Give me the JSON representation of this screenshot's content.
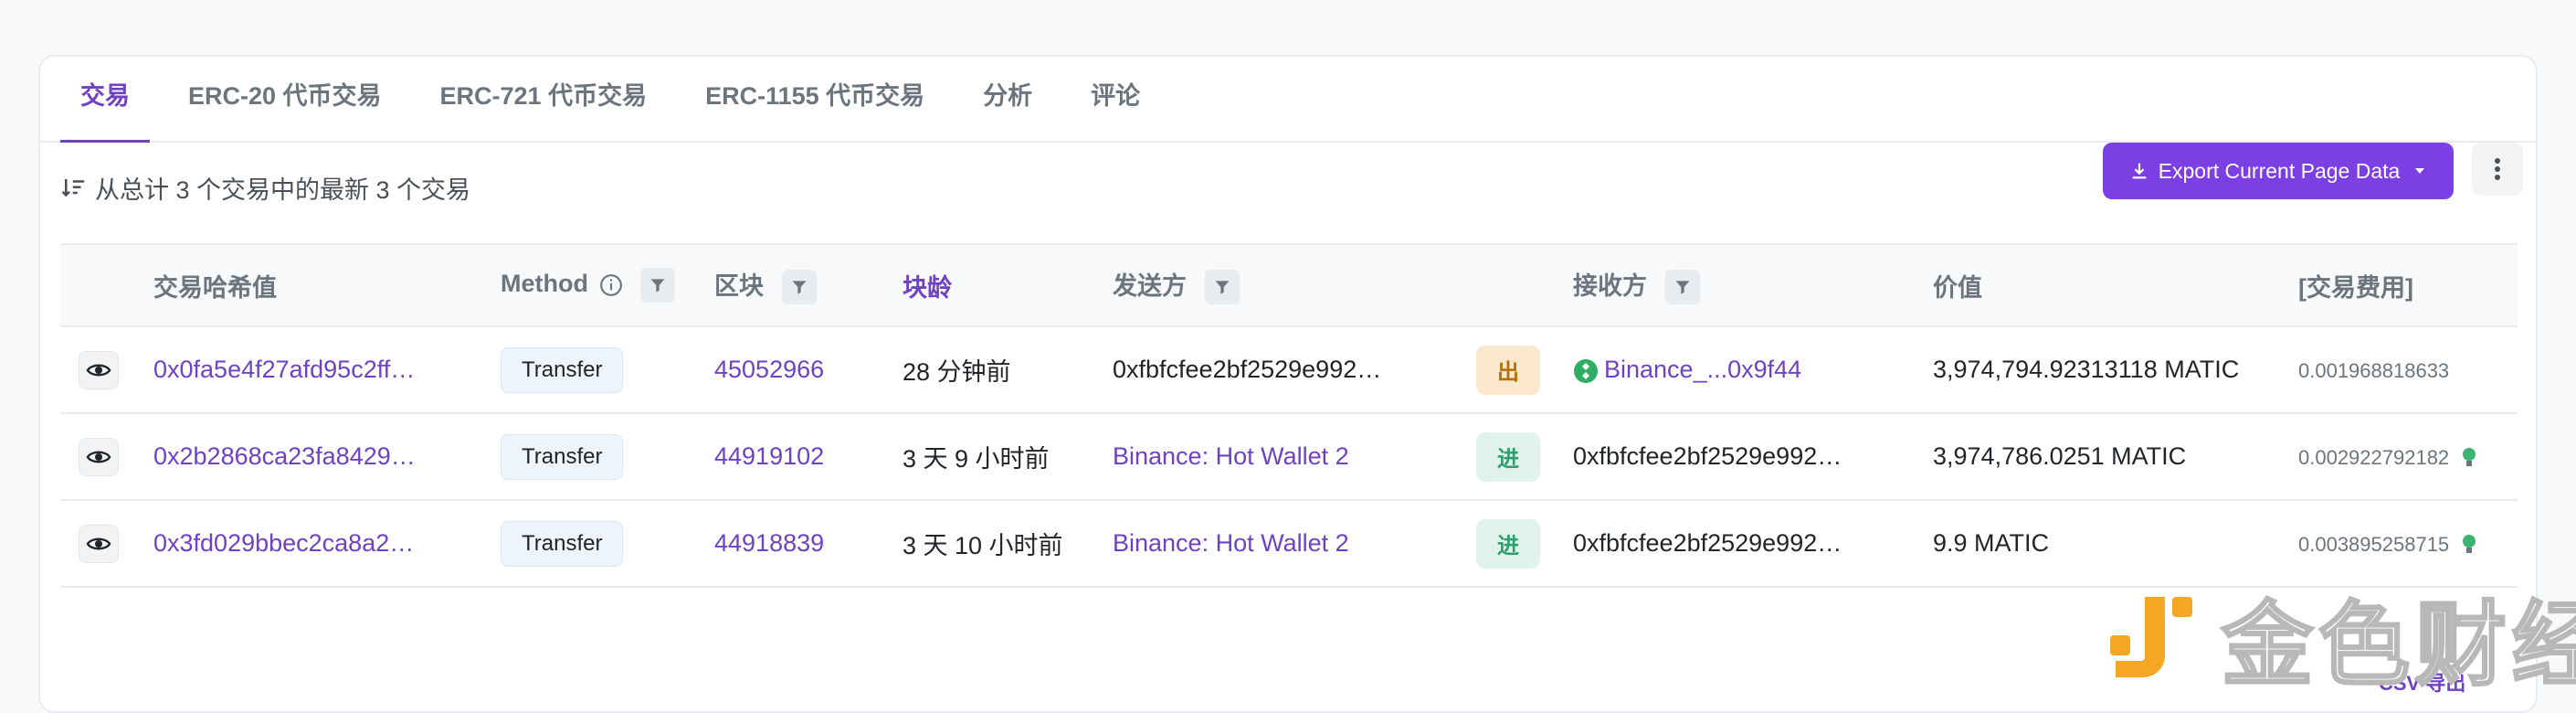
{
  "tabs": [
    {
      "label": "交易",
      "active": true
    },
    {
      "label": "ERC-20 代币交易"
    },
    {
      "label": "ERC-721 代币交易"
    },
    {
      "label": "ERC-1155 代币交易"
    },
    {
      "label": "分析"
    },
    {
      "label": "评论"
    }
  ],
  "summary": "从总计 3 个交易中的最新 3 个交易",
  "export_label": "Export Current Page Data",
  "columns": {
    "hash": "交易哈希值",
    "method": "Method",
    "block": "区块",
    "age": "块龄",
    "from": "发送方",
    "to": "接收方",
    "value": "价值",
    "fee": "[交易费用]"
  },
  "rows": [
    {
      "hash": "0x0fa5e4f27afd95c2ff…",
      "method": "Transfer",
      "block": "45052966",
      "age": "28 分钟前",
      "from": "0xfbfcfee2bf2529e992…",
      "from_link": false,
      "direction": "出",
      "to": "Binance_...0x9f44",
      "to_link": true,
      "value": "3,974,794.92313118 MATIC",
      "fee": "0.001968818633"
    },
    {
      "hash": "0x2b2868ca23fa8429…",
      "method": "Transfer",
      "block": "44919102",
      "age": "3 天 9 小时前",
      "from": "Binance: Hot Wallet 2",
      "from_link": true,
      "direction": "进",
      "to": "0xfbfcfee2bf2529e992…",
      "to_link": false,
      "value": "3,974,786.0251 MATIC",
      "fee": "0.002922792182"
    },
    {
      "hash": "0x3fd029bbec2ca8a2…",
      "method": "Transfer",
      "block": "44918839",
      "age": "3 天 10 小时前",
      "from": "Binance: Hot Wallet 2",
      "from_link": true,
      "direction": "进",
      "to": "0xfbfcfee2bf2529e992…",
      "to_link": false,
      "value": "9.9 MATIC",
      "fee": "0.003895258715"
    }
  ],
  "csv_label": "CSV 导出",
  "watermark": "金色财经",
  "colors": {
    "accent": "#6f42c1",
    "button": "#7b3fe4",
    "out_badge": "#fbe8cc",
    "in_badge": "#dff3ea",
    "watermark_logo": "#f5a623"
  }
}
